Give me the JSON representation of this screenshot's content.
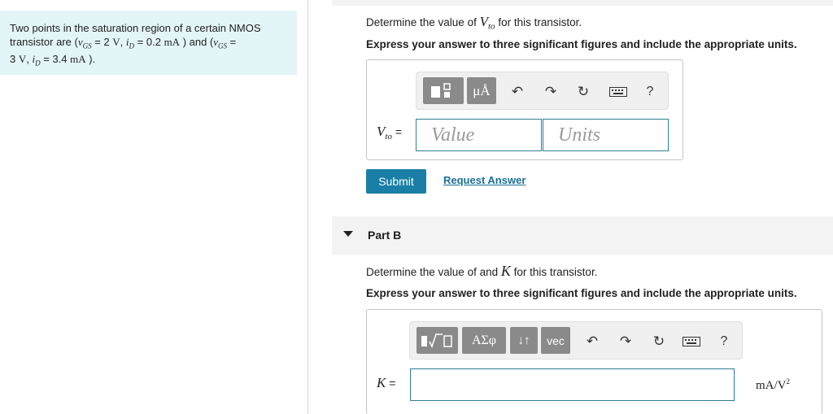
{
  "problem": {
    "line1": "Two points in the saturation region of a certain NMOS",
    "line2_prefix": "transistor are (",
    "vgs_sym": "v",
    "vgs_sub": "GS",
    "eq_val1": "= 2",
    "unit_v": "V",
    "id_sym": "i",
    "id_sub": "D",
    "eq_val2": "= 0.2",
    "unit_ma": "mA",
    "line2_mid": ") and (",
    "eq_tail": "=",
    "line3_val1": "3",
    "eq_val3": "= 3.4",
    "line3_end": ")."
  },
  "part_a": {
    "question_prefix": "Determine the value of",
    "var_main": "V",
    "var_sub": "to",
    "question_suffix": "for this transistor.",
    "instruction": "Express your answer to three significant figures and include the appropriate units.",
    "toolbar": {
      "units_btn": "μÅ",
      "help": "?"
    },
    "input_label_main": "V",
    "input_label_sub": "to",
    "input_eq": "=",
    "value_placeholder": "Value",
    "units_placeholder": "Units",
    "submit": "Submit",
    "request_answer": "Request Answer"
  },
  "part_b": {
    "title": "Part B",
    "question_prefix": "Determine the value of and",
    "var": "K",
    "question_suffix": "for this transistor.",
    "instruction": "Express your answer to three significant figures and include the appropriate units.",
    "toolbar": {
      "sqrt_btn": "√",
      "greek_btn": "ΑΣφ",
      "arrows_btn": "↓↑",
      "vec_btn": "vec",
      "help": "?"
    },
    "input_label": "K",
    "input_eq": "=",
    "units_text": "mA/V",
    "units_sup": "2"
  }
}
